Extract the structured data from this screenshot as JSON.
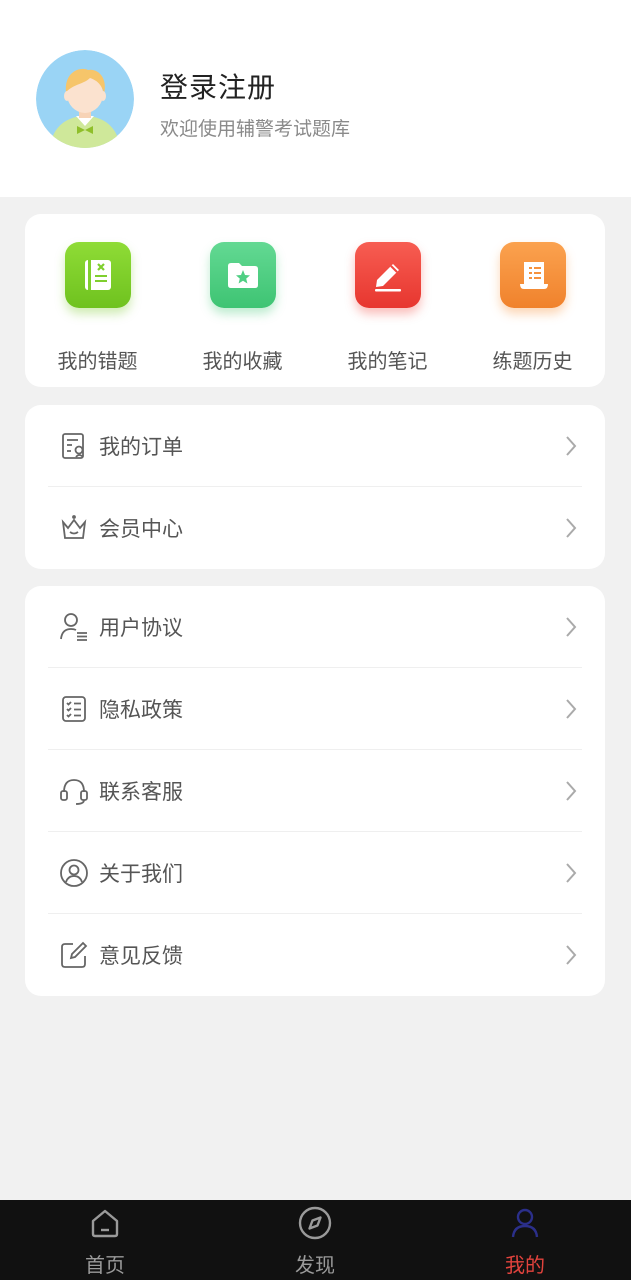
{
  "profile": {
    "title": "登录注册",
    "subtitle": "欢迎使用辅警考试题库"
  },
  "quick_actions": [
    {
      "label": "我的错题",
      "icon": "wrong-book-icon",
      "color": "#7fcf2e"
    },
    {
      "label": "我的收藏",
      "icon": "favorite-folder-icon",
      "color": "#4fcf83"
    },
    {
      "label": "我的笔记",
      "icon": "note-pen-icon",
      "color": "#f2463e"
    },
    {
      "label": "练题历史",
      "icon": "history-scroll-icon",
      "color": "#f6923d"
    }
  ],
  "menu_group_1": [
    {
      "label": "我的订单",
      "icon": "order-icon"
    },
    {
      "label": "会员中心",
      "icon": "crown-icon"
    }
  ],
  "menu_group_2": [
    {
      "label": "用户协议",
      "icon": "user-agreement-icon"
    },
    {
      "label": "隐私政策",
      "icon": "privacy-list-icon"
    },
    {
      "label": "联系客服",
      "icon": "headset-icon"
    },
    {
      "label": "关于我们",
      "icon": "user-circle-icon"
    },
    {
      "label": "意见反馈",
      "icon": "edit-feedback-icon"
    }
  ],
  "tabbar": [
    {
      "label": "首页",
      "icon": "home-icon",
      "active": false
    },
    {
      "label": "发现",
      "icon": "compass-icon",
      "active": false
    },
    {
      "label": "我的",
      "icon": "profile-icon",
      "active": true
    }
  ],
  "colors": {
    "accent": "#e2433d",
    "tab_active_icon": "#2b2f8a",
    "page_bg": "#f1f1f1"
  }
}
